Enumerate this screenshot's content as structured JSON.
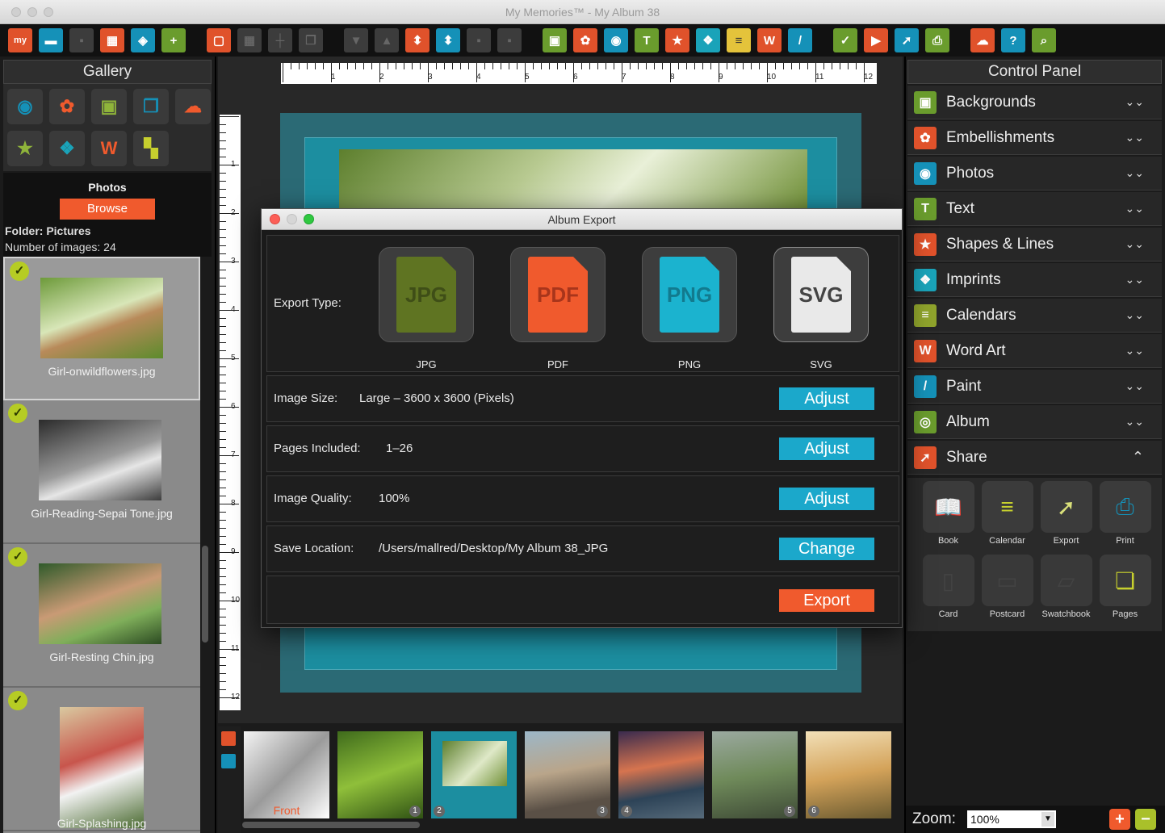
{
  "window": {
    "title": "My Memories™ - My Album 38"
  },
  "toolbar": {
    "buttons": [
      {
        "name": "my-logo-button",
        "glyph": "my",
        "color": "orange"
      },
      {
        "name": "open-folder-icon",
        "glyph": "▬",
        "color": "blue"
      },
      {
        "name": "save-icon",
        "glyph": "▪",
        "color": "dim"
      },
      {
        "name": "layout-icon",
        "glyph": "▦",
        "color": "orange"
      },
      {
        "name": "album-icon",
        "glyph": "◈",
        "color": "blue"
      },
      {
        "name": "add-page-icon",
        "glyph": "+",
        "color": "green"
      },
      {
        "name": "frame-icon",
        "glyph": "▢",
        "color": "orange",
        "gap": true
      },
      {
        "name": "grid-icon",
        "glyph": "▦",
        "color": "dim"
      },
      {
        "name": "guides-icon",
        "glyph": "┼",
        "color": "dim"
      },
      {
        "name": "copy-icon",
        "glyph": "❐",
        "color": "dim"
      },
      {
        "name": "page-down-icon",
        "glyph": "▼",
        "color": "dim",
        "gap": true
      },
      {
        "name": "page-up-icon",
        "glyph": "▲",
        "color": "dim"
      },
      {
        "name": "import-page-icon",
        "glyph": "⬍",
        "color": "orange"
      },
      {
        "name": "export-page-icon",
        "glyph": "⬍",
        "color": "blue"
      },
      {
        "name": "lock-icon",
        "glyph": "▪",
        "color": "dim"
      },
      {
        "name": "unlock-icon",
        "glyph": "▪",
        "color": "dim"
      },
      {
        "name": "backgrounds-icon",
        "glyph": "▣",
        "color": "green",
        "gap": true
      },
      {
        "name": "embellishments-icon",
        "glyph": "✿",
        "color": "orange"
      },
      {
        "name": "camera-icon",
        "glyph": "◉",
        "color": "blue"
      },
      {
        "name": "text-icon",
        "glyph": "T",
        "color": "green"
      },
      {
        "name": "shapes-icon",
        "glyph": "★",
        "color": "orange"
      },
      {
        "name": "imprints-icon",
        "glyph": "❖",
        "color": "teal"
      },
      {
        "name": "calendar-icon",
        "glyph": "≡",
        "color": "yellow"
      },
      {
        "name": "word-art-icon",
        "glyph": "W",
        "color": "orange"
      },
      {
        "name": "paint-icon",
        "glyph": "/",
        "color": "blue"
      },
      {
        "name": "check-icon",
        "glyph": "✓",
        "color": "green",
        "gap": true
      },
      {
        "name": "play-icon",
        "glyph": "▶",
        "color": "orange"
      },
      {
        "name": "share-icon",
        "glyph": "➚",
        "color": "blue"
      },
      {
        "name": "print-icon",
        "glyph": "⎙",
        "color": "green"
      },
      {
        "name": "cloud-icon",
        "glyph": "☁",
        "color": "orange",
        "gap": true
      },
      {
        "name": "help-icon",
        "glyph": "?",
        "color": "blue"
      },
      {
        "name": "search-icon",
        "glyph": "⌕",
        "color": "green"
      }
    ]
  },
  "gallery": {
    "title": "Gallery",
    "icons": [
      {
        "name": "gallery-camera-icon",
        "glyph": "◉",
        "color": "#1591b8"
      },
      {
        "name": "gallery-flower-icon",
        "glyph": "✿",
        "color": "#f05a2d"
      },
      {
        "name": "gallery-image-icon",
        "glyph": "▣",
        "color": "#8fb43a"
      },
      {
        "name": "gallery-frames-icon",
        "glyph": "❐",
        "color": "#1591b8"
      },
      {
        "name": "gallery-cloud-icon",
        "glyph": "☁",
        "color": "#f05a2d"
      },
      {
        "name": "gallery-star-icon",
        "glyph": "★",
        "color": "#8fb43a"
      },
      {
        "name": "gallery-butterfly-icon",
        "glyph": "❖",
        "color": "#1aa3b9"
      },
      {
        "name": "gallery-wordart-icon",
        "glyph": "W",
        "color": "#f05a2d"
      },
      {
        "name": "gallery-layout-icon",
        "glyph": "▚",
        "color": "#c7d02e"
      }
    ],
    "photos_label": "Photos",
    "browse_label": "Browse",
    "folder_text": "Folder: Pictures",
    "count_text": "Number of images: 24",
    "thumbnails": [
      {
        "name": "Girl-onwildflowers.jpg",
        "selected": true
      },
      {
        "name": "Girl-Reading-Sepai Tone.jpg",
        "selected": false
      },
      {
        "name": "Girl-Resting Chin.jpg",
        "selected": false
      },
      {
        "name": "Girl-Splashing.jpg",
        "selected": false
      }
    ]
  },
  "rulers": {
    "h": [
      "1",
      "2",
      "3",
      "4",
      "5",
      "6",
      "7",
      "8",
      "9",
      "10",
      "11",
      "12"
    ],
    "v": [
      "1",
      "2",
      "3",
      "4",
      "5",
      "6",
      "7",
      "8",
      "9",
      "10",
      "11",
      "12"
    ]
  },
  "filmstrip": {
    "pages": [
      {
        "label": "Front",
        "num": ""
      },
      {
        "label": "",
        "num": "1"
      },
      {
        "label": "",
        "num": "2",
        "selected": true
      },
      {
        "label": "",
        "num": "3"
      },
      {
        "label": "",
        "num": "4"
      },
      {
        "label": "",
        "num": "5"
      },
      {
        "label": "",
        "num": "6"
      }
    ]
  },
  "control_panel": {
    "title": "Control Panel",
    "items": [
      {
        "label": "Backgrounds",
        "icon": "backgrounds-icon",
        "glyph": "▣",
        "color": "#6a9c2d",
        "expanded": false
      },
      {
        "label": "Embellishments",
        "icon": "embellishments-icon",
        "glyph": "✿",
        "color": "#e0522b",
        "expanded": false
      },
      {
        "label": "Photos",
        "icon": "photos-icon",
        "glyph": "◉",
        "color": "#1591b8",
        "expanded": false
      },
      {
        "label": "Text",
        "icon": "text-icon",
        "glyph": "T",
        "color": "#6a9c2d",
        "expanded": false
      },
      {
        "label": "Shapes & Lines",
        "icon": "shapes-icon",
        "glyph": "★",
        "color": "#e0522b",
        "expanded": false
      },
      {
        "label": "Imprints",
        "icon": "imprints-icon",
        "glyph": "❖",
        "color": "#1aa3b9",
        "expanded": false
      },
      {
        "label": "Calendars",
        "icon": "calendars-icon",
        "glyph": "≡",
        "color": "#8fa32c",
        "expanded": false
      },
      {
        "label": "Word Art",
        "icon": "word-art-icon",
        "glyph": "W",
        "color": "#e0522b",
        "expanded": false
      },
      {
        "label": "Paint",
        "icon": "paint-icon",
        "glyph": "/",
        "color": "#1591b8",
        "expanded": false
      },
      {
        "label": "Album",
        "icon": "album-icon",
        "glyph": "◎",
        "color": "#6a9c2d",
        "expanded": false
      },
      {
        "label": "Share",
        "icon": "share-icon",
        "glyph": "➚",
        "color": "#e0522b",
        "expanded": true
      }
    ],
    "share_items": [
      {
        "label": "Book",
        "icon": "book-icon",
        "glyph": "📖",
        "color": "#1591b8",
        "enabled": true
      },
      {
        "label": "Calendar",
        "icon": "calendar-icon",
        "glyph": "≡",
        "color": "#c7d02e",
        "enabled": true
      },
      {
        "label": "Export",
        "icon": "export-icon",
        "glyph": "➚",
        "color": "#d9e07a",
        "enabled": true
      },
      {
        "label": "Print",
        "icon": "print-icon",
        "glyph": "⎙",
        "color": "#1591b8",
        "enabled": true
      },
      {
        "label": "Card",
        "icon": "card-icon",
        "glyph": "▯",
        "color": "#555",
        "enabled": false
      },
      {
        "label": "Postcard",
        "icon": "postcard-icon",
        "glyph": "▭",
        "color": "#555",
        "enabled": false
      },
      {
        "label": "Swatchbook",
        "icon": "swatchbook-icon",
        "glyph": "▱",
        "color": "#555",
        "enabled": false
      },
      {
        "label": "Pages",
        "icon": "pages-icon",
        "glyph": "❏",
        "color": "#c7d02e",
        "enabled": true
      }
    ],
    "zoom_label": "Zoom:",
    "zoom_value": "100%"
  },
  "dialog": {
    "title": "Album Export",
    "export_type_label": "Export Type:",
    "types": [
      {
        "label": "JPG",
        "doc": "JPG",
        "color": "#5f7422",
        "text": "#3f4e17",
        "selected": false
      },
      {
        "label": "PDF",
        "doc": "PDF",
        "color": "#f05a2d",
        "text": "#a8351b",
        "selected": false
      },
      {
        "label": "PNG",
        "doc": "PNG",
        "color": "#1bb3cf",
        "text": "#127a8e",
        "selected": false
      },
      {
        "label": "SVG",
        "doc": "SVG",
        "color": "#e9e9e9",
        "text": "#444",
        "selected": true
      }
    ],
    "image_size_label": "Image Size:",
    "image_size_value": "Large – 3600 x 3600 (Pixels)",
    "pages_label": "Pages Included:",
    "pages_value": "1–26",
    "quality_label": "Image Quality:",
    "quality_value": "100%",
    "location_label": "Save Location:",
    "location_value": "/Users/mallred/Desktop/My Album 38_JPG",
    "adjust_label": "Adjust",
    "change_label": "Change",
    "export_label": "Export"
  }
}
